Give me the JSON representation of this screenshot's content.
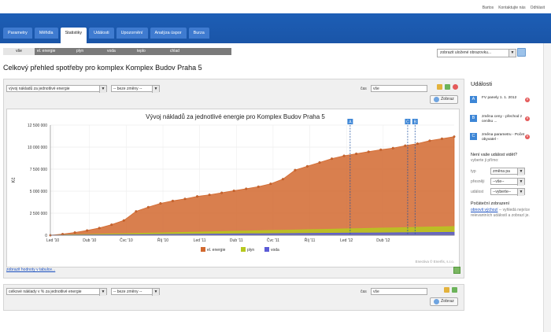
{
  "top_links": [
    "Bartos",
    "Kontaktujte nás",
    "Odhlásit"
  ],
  "tabs": [
    "Parametry",
    "Měřidla",
    "Statistiky",
    "Události",
    "Upozornění",
    "Analýza úspor",
    "Burza"
  ],
  "active_tab": "Statistiky",
  "energy_tabs": [
    "vše",
    "el. energie",
    "plyn",
    "voda",
    "teplo",
    "chlad"
  ],
  "saved_views_select": "zobrazit uložené obrazovku...",
  "page_title": "Celkový přehled spotřeby pro komplex Komplex Budov Praha 5",
  "panel1": {
    "metric_select": "vývoj nákladů za jednotlivé energie",
    "change_select": "-- beze změny --",
    "time_label": "čas",
    "time_value": "vše",
    "show_button": "Zobraz",
    "table_link": "zobrazit hodnoty v tabulce..."
  },
  "panel2": {
    "metric_select": "celkové náklady v % za jednotlivé energie",
    "change_select": "-- beze změny --",
    "time_label": "čas",
    "time_value": "vše",
    "show_button": "Zobraz"
  },
  "chart_data": {
    "type": "area",
    "title": "Vývoj nákladů za jednotlivé energie pro Komplex Budov Praha 5",
    "ylabel": "Kč",
    "xlabel": "",
    "ylim": [
      0,
      12500000
    ],
    "yticks": [
      "0",
      "2 500 000",
      "5 000 000",
      "7 500 000",
      "10 000 000",
      "12 500 000"
    ],
    "xticks": [
      "Led '10",
      "Dub '10",
      "Čvc '10",
      "Říj '10",
      "Led '11",
      "Dub '11",
      "Čvc '11",
      "Říj '11",
      "Led '12",
      "Dub '12"
    ],
    "grid": true,
    "legend_position": "bottom",
    "credit": "Enectiva © Enerfis, s.r.o.",
    "event_markers": [
      "A",
      "C",
      "B"
    ],
    "series": [
      {
        "name": "el. energie",
        "color": "#d2692f",
        "values": [
          0,
          100000,
          250000,
          450000,
          700000,
          1050000,
          1500000,
          2500000,
          2950000,
          3350000,
          3600000,
          3800000,
          4050000,
          4200000,
          4400000,
          4600000,
          4800000,
          5000000,
          5300000,
          5800000,
          6800000,
          7200000,
          7600000,
          8000000,
          8300000,
          8500000,
          8700000,
          8900000,
          9050000,
          9300000,
          9500000,
          9800000,
          10000000,
          10200000
        ]
      },
      {
        "name": "plyn",
        "color": "#b6c81f",
        "values": [
          0,
          20000,
          40000,
          60000,
          80000,
          100000,
          120000,
          140000,
          160000,
          180000,
          200000,
          220000,
          240000,
          260000,
          280000,
          300000,
          320000,
          340000,
          360000,
          380000,
          400000,
          420000,
          440000,
          460000,
          480000,
          500000,
          520000,
          540000,
          560000,
          580000,
          600000,
          620000,
          640000,
          660000
        ]
      },
      {
        "name": "voda",
        "color": "#5b5bd6",
        "values": [
          0,
          10000,
          20000,
          30000,
          40000,
          50000,
          60000,
          70000,
          80000,
          90000,
          100000,
          110000,
          120000,
          130000,
          140000,
          150000,
          160000,
          170000,
          180000,
          190000,
          200000,
          210000,
          220000,
          230000,
          240000,
          250000,
          260000,
          270000,
          280000,
          290000,
          300000,
          310000,
          320000,
          330000
        ]
      }
    ]
  },
  "sidebar": {
    "title": "Události",
    "events": [
      {
        "badge": "A",
        "text": "FV panely 1. 1. 2012"
      },
      {
        "badge": "B",
        "text": "změna ceny - přechod z ceníku ..."
      },
      {
        "badge": "C",
        "text": "změna parametru - Počet obyvatel -"
      }
    ],
    "question": "Není vaše událost vidět?",
    "question_sub": "vyberte ji přímo:",
    "filters": [
      {
        "label": "typ",
        "value": "změna pa"
      },
      {
        "label": "přesněji",
        "value": "--vše--"
      },
      {
        "label": "událost",
        "value": "--vyberte--"
      }
    ],
    "initial_title": "Počáteční zobrazení",
    "initial_link": "obnovit výchozí",
    "initial_text": " -- vyhledá nejvíce relevantních událostí a zobrazí je."
  }
}
